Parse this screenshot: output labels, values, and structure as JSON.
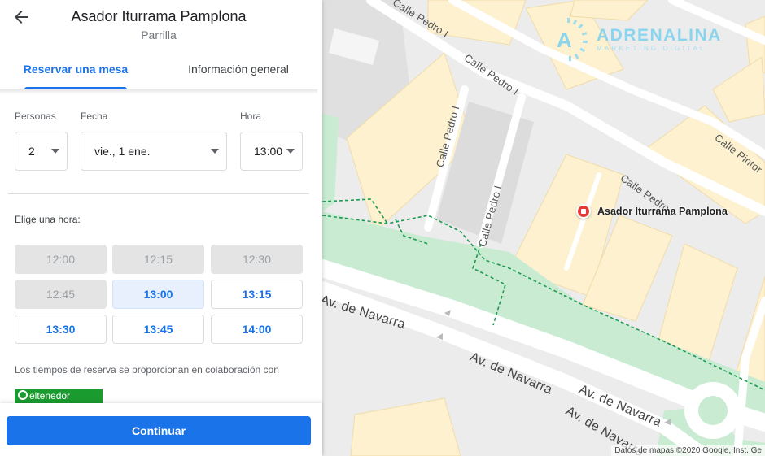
{
  "header": {
    "title": "Asador Iturrama Pamplona",
    "subtitle": "Parrilla"
  },
  "tabs": [
    {
      "label": "Reservar una mesa",
      "active": true
    },
    {
      "label": "Información general",
      "active": false
    }
  ],
  "form": {
    "party": {
      "label": "Personas",
      "value": "2"
    },
    "date": {
      "label": "Fecha",
      "value": "vie., 1 ene."
    },
    "time": {
      "label": "Hora",
      "value": "13:00"
    }
  },
  "choose_time_label": "Elige una hora:",
  "time_slots": [
    {
      "time": "12:00",
      "state": "disabled"
    },
    {
      "time": "12:15",
      "state": "disabled"
    },
    {
      "time": "12:30",
      "state": "disabled"
    },
    {
      "time": "12:45",
      "state": "disabled"
    },
    {
      "time": "13:00",
      "state": "selected"
    },
    {
      "time": "13:15",
      "state": "available"
    },
    {
      "time": "13:30",
      "state": "available"
    },
    {
      "time": "13:45",
      "state": "available"
    },
    {
      "time": "14:00",
      "state": "available"
    }
  ],
  "partner": {
    "text": "Los tiempos de reserva se proporcionan en colaboración con",
    "name": "eltenedor"
  },
  "continue_label": "Continuar",
  "map": {
    "streets": {
      "pedro_top": "Calle Pedro I",
      "pedro_right": "Calle Pedro I",
      "pedro_center": "Calle Pedro I",
      "pedro_lower": "Calle Pedro I",
      "pintor": "Calle Pintor",
      "navarra_1": "Av. de Navarra",
      "navarra_2": "Av. de Navarra",
      "navarra_3": "Av. de Navarra",
      "navarra_4": "Av. de Navarra"
    },
    "marker_label": "Asador Iturrama Pamplona",
    "attribution": "Datos de mapas ©2020 Google, Inst. Ge",
    "watermark": {
      "name": "ADRENALINA",
      "tagline": "MARKETING DIGITAL"
    }
  },
  "colors": {
    "accent": "#1a73e8",
    "marker": "#e53935",
    "park": "#c8ebd1",
    "building": "#fdf1d0",
    "partner_brand": "#1a9b2f"
  }
}
